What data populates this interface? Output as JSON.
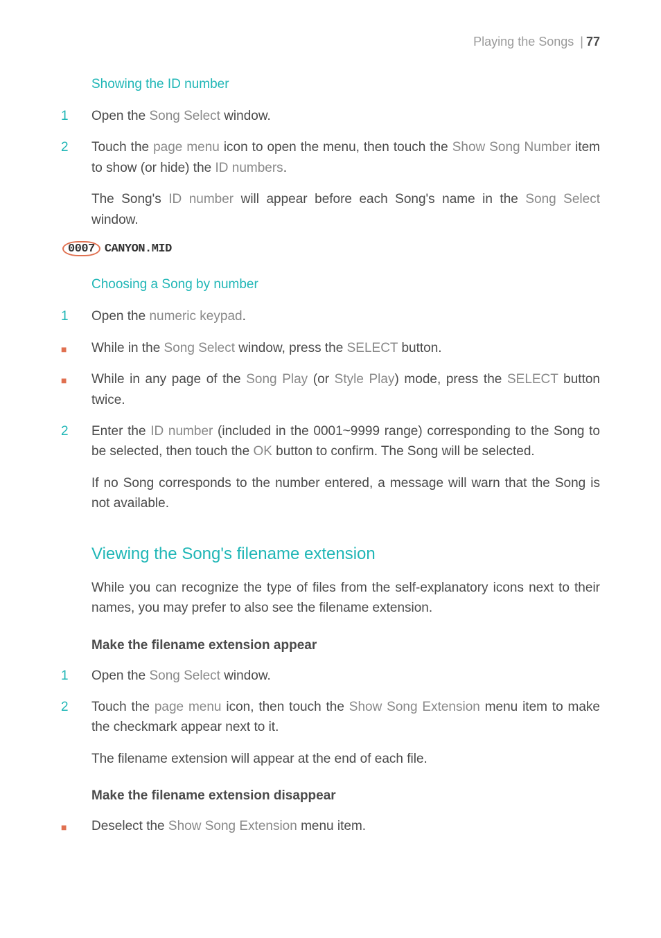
{
  "header": {
    "section": "Playing the Songs",
    "page": "77"
  },
  "h_showing_id": "Showing the ID number",
  "s1": {
    "n1": "1",
    "b1_a": "Open the ",
    "b1_t1": "Song Select",
    "b1_b": " window.",
    "n2": "2",
    "b2_a": "Touch the ",
    "b2_t1": "page menu",
    "b2_b": " icon to open the menu, then touch the ",
    "b2_t2": "Show Song Number",
    "b2_c": " item to show (or hide) the ",
    "b2_t3": "ID numbers",
    "b2_d": ".",
    "p1_a": "The Song's ",
    "p1_t1": "ID number",
    "p1_b": " will appear before each Song's name in the ",
    "p1_t2": "Song Select",
    "p1_c": " window."
  },
  "example": {
    "id": "0007",
    "filename": "CANYON.MID"
  },
  "h_choosing": "Choosing a Song by number",
  "s2": {
    "n1": "1",
    "b1_a": "Open the ",
    "b1_t1": "numeric keypad",
    "b1_b": ".",
    "bul": "■",
    "b2_a": "While in the ",
    "b2_t1": "Song Select",
    "b2_b": " window, press the ",
    "b2_t2": "SELECT",
    "b2_c": " button.",
    "b3_a": "While in any page of the ",
    "b3_t1": "Song Play",
    "b3_b": " (or ",
    "b3_t2": "Style Play",
    "b3_c": ") mode, press the ",
    "b3_t3": "SELECT",
    "b3_d": " button twice.",
    "n2": "2",
    "b4_a": "Enter the ",
    "b4_t1": "ID number",
    "b4_b": " (included in the 0001~9999 range) corresponding to the Song to be selected, then touch the ",
    "b4_t2": "OK",
    "b4_c": " button to confirm. The Song will be selected.",
    "p1": "If no Song corresponds to the number entered, a message will warn that the Song is not available."
  },
  "h_viewing": "Viewing the Song's filename extension",
  "s3": {
    "intro": "While you can recognize the type of files from the self-explanatory icons next to their names, you may prefer to also see the filename extension.",
    "h_appear": "Make the filename extension appear",
    "n1": "1",
    "b1_a": "Open the ",
    "b1_t1": "Song Select",
    "b1_b": " window.",
    "n2": "2",
    "b2_a": "Touch the ",
    "b2_t1": "page menu",
    "b2_b": " icon, then touch the ",
    "b2_t2": "Show Song Extension",
    "b2_c": " menu item to make the checkmark appear next to it.",
    "p1": "The filename extension will appear at the end of each file.",
    "h_disappear": "Make the filename extension disappear",
    "bul": "■",
    "b3_a": "Deselect the ",
    "b3_t1": "Show Song Extension",
    "b3_b": " menu item."
  }
}
